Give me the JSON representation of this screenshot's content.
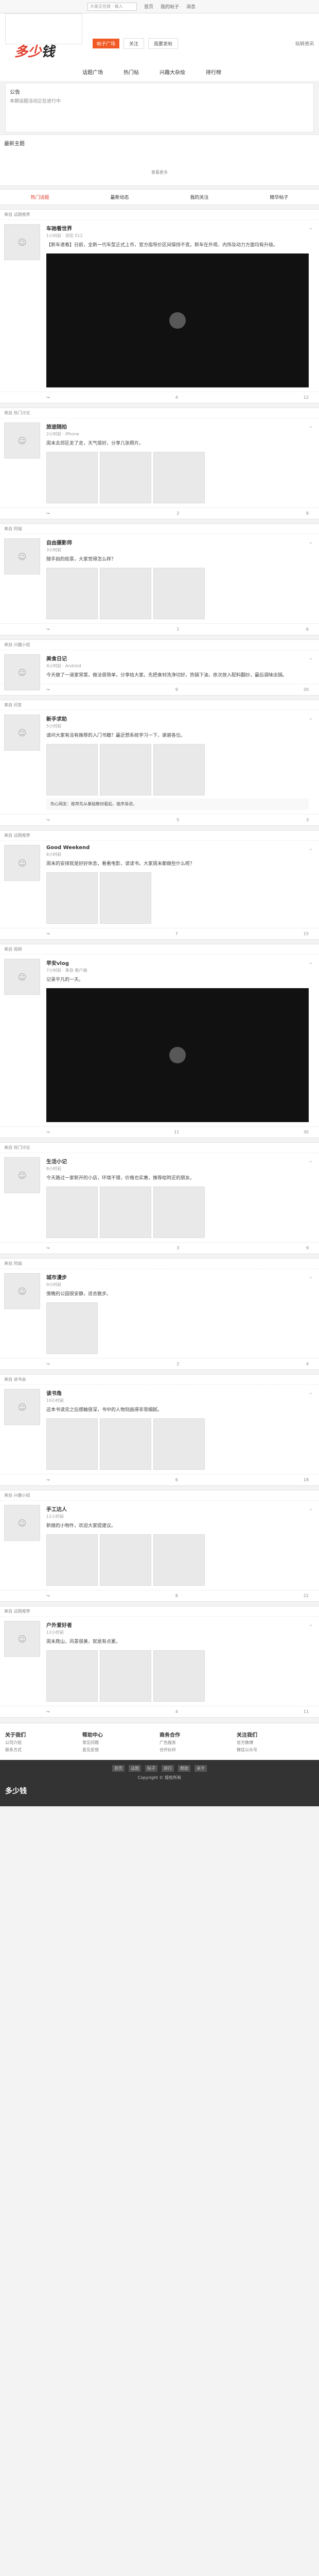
{
  "topbar": {
    "search_placeholder": "大家正在搜 · 输入",
    "links": [
      "首页",
      "我的帖子",
      "消息"
    ]
  },
  "header": {
    "logo_prefix": "多少",
    "logo_suffix": "钱",
    "tag": "帖子广场",
    "follow": "关注",
    "share": "我要发帖",
    "right": "玩转资讯"
  },
  "nav": [
    "话题广场",
    "热门帖",
    "兴趣大杂烩",
    "排行榜"
  ],
  "announcement": {
    "title": "公告",
    "text": "本期话题活动正在进行中"
  },
  "topics": {
    "title": "最新主题",
    "more": "查看更多"
  },
  "tabs": [
    "热门话题",
    "最新动态",
    "我的关注",
    "精华帖子"
  ],
  "posts": [
    {
      "head": "来自 话题推荐",
      "user": "车驰看世界",
      "meta": "1小时前 · 浏览 512",
      "text": "【新车速看】日前，全新一代车型正式上市，官方指导价区间保持不变。新车在外观、内饰及动力方面均有升级。",
      "video": true,
      "likes": "12",
      "comments": "4"
    },
    {
      "head": "来自 热门讨论",
      "user": "旅途随拍",
      "meta": "2小时前 · iPhone",
      "text": "周末去郊区走了走，天气很好，分享几张照片。",
      "images": 3,
      "likes": "8",
      "comments": "2"
    },
    {
      "head": "来自 同城",
      "user": "自由摄影师",
      "meta": "3小时前",
      "text": "随手拍的街景，大家觉得怎么样？",
      "images": 3,
      "likes": "6",
      "comments": "1"
    },
    {
      "head": "来自 兴趣小组",
      "user": "美食日记",
      "meta": "4小时前 · Android",
      "text": "今天做了一道家常菜，做法很简单，分享给大家。先把食材洗净切好，热锅下油，依次放入配料翻炒，最后调味出锅。",
      "likes": "20",
      "comments": "9"
    },
    {
      "head": "来自 问答",
      "user": "新手求助",
      "meta": "5小时前",
      "text": "请问大家有没有推荐的入门书籍？最近想系统学习一下，谢谢各位。",
      "images": 3,
      "comment": "热心网友：推荐先从基础教材看起，循序渐进。",
      "likes": "3",
      "comments": "5"
    },
    {
      "head": "来自 话题推荐",
      "user": "Good Weekend",
      "meta": "6小时前",
      "text": "周末的安排就是好好休息，看看电影，读读书。大家周末都做些什么呢？",
      "images": 2,
      "likes": "15",
      "comments": "7"
    },
    {
      "head": "来自 视频",
      "user": "早安vlog",
      "meta": "7小时前 · 来自 客户端",
      "text": "记录平凡的一天。",
      "video": true,
      "likes": "30",
      "comments": "11"
    },
    {
      "head": "来自 热门讨论",
      "user": "生活小记",
      "meta": "8小时前",
      "text": "今天路过一家新开的小店，环境不错，价格也实惠，推荐给附近的朋友。",
      "images": 3,
      "likes": "9",
      "comments": "3"
    },
    {
      "head": "来自 同城",
      "user": "城市漫步",
      "meta": "9小时前",
      "text": "傍晚的公园很安静，适合散步。",
      "images": 1,
      "likes": "4",
      "comments": "2"
    },
    {
      "head": "来自 读书会",
      "user": "读书角",
      "meta": "10小时前",
      "text": "这本书读完之后感触很深，书中的人物刻画得非常细腻。",
      "images": 3,
      "likes": "18",
      "comments": "6"
    },
    {
      "head": "来自 兴趣小组",
      "user": "手工达人",
      "meta": "11小时前",
      "text": "新做的小物件，欢迎大家提建议。",
      "images": 3,
      "likes": "22",
      "comments": "8"
    },
    {
      "head": "来自 话题推荐",
      "user": "户外爱好者",
      "meta": "12小时前",
      "text": "周末爬山，风景很美，就是有点累。",
      "images": 3,
      "likes": "11",
      "comments": "4"
    }
  ],
  "footer": {
    "cols": [
      {
        "title": "关于我们",
        "items": [
          "公司介绍",
          "联系方式"
        ]
      },
      {
        "title": "帮助中心",
        "items": [
          "常见问题",
          "意见反馈"
        ]
      },
      {
        "title": "商务合作",
        "items": [
          "广告服务",
          "合作伙伴"
        ]
      },
      {
        "title": "关注我们",
        "items": [
          "官方微博",
          "微信公众号"
        ]
      }
    ]
  },
  "bottom": {
    "nav": [
      "首页",
      "话题",
      "帖子",
      "排行",
      "帮助",
      "关于"
    ],
    "copyright": "Copyright © 版权所有"
  }
}
